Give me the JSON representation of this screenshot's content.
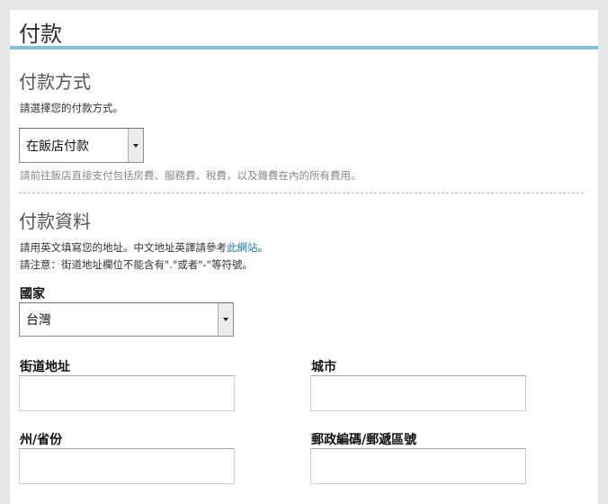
{
  "page": {
    "title": "付款"
  },
  "payment_method": {
    "heading": "付款方式",
    "instruction": "請選擇您的付款方式。",
    "selected": "在飯店付款",
    "note": "請前往飯店直接支付包括房費、服務費、稅費，以及雜費在內的所有費用。"
  },
  "payment_info": {
    "heading": "付款資料",
    "instruction_prefix": "請用英文填寫您的地址。中文地址英譯請參考",
    "instruction_link": "此網站",
    "instruction_suffix": "。",
    "caution": "請注意：街道地址欄位不能含有\".\"或者\"-\"等符號。"
  },
  "form": {
    "country_label": "國家",
    "country_value": "台灣",
    "street_label": "街道地址",
    "street_value": "",
    "city_label": "城市",
    "city_value": "",
    "state_label": "州/省份",
    "state_value": "",
    "postal_label": "郵政編碼/郵遞區號",
    "postal_value": ""
  },
  "colors": {
    "accent_rule": "#7ec3d8",
    "link": "#1a7cb3",
    "background": "#e6e6e6"
  }
}
